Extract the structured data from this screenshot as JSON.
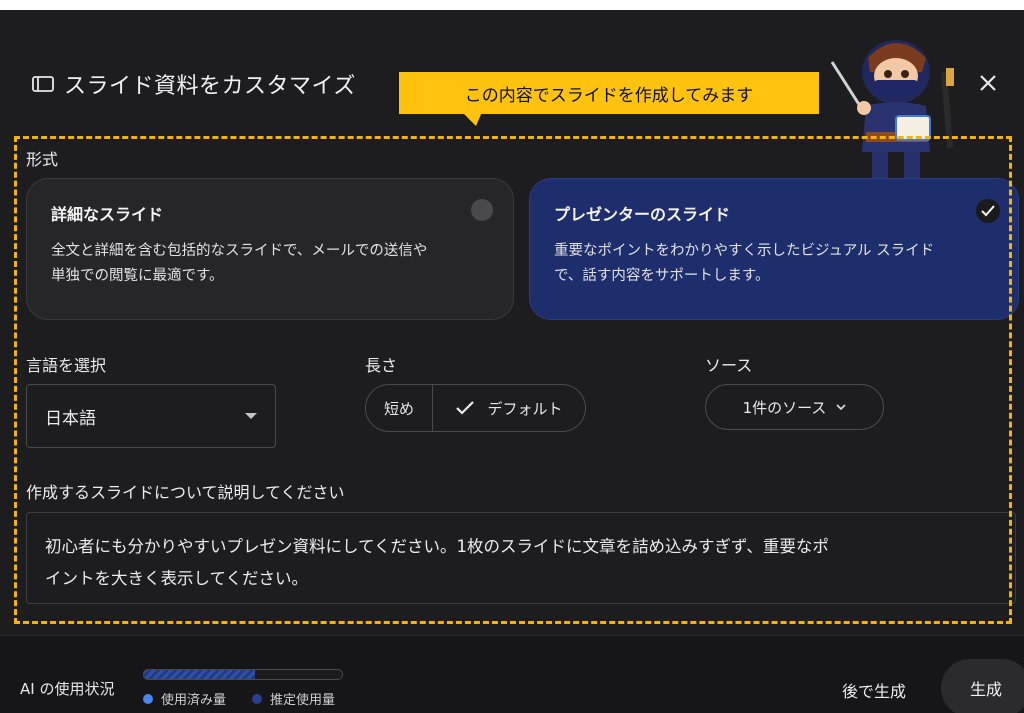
{
  "dialog": {
    "title": "スライド資料をカスタマイズ",
    "close_icon": "close-icon"
  },
  "callout": {
    "text": "この内容でスライドを作成してみます"
  },
  "format": {
    "label": "形式",
    "options": [
      {
        "title": "詳細なスライド",
        "description_line1": "全文と詳細を含む包括的なスライドで、メールでの送信や",
        "description_line2": "単独での閲覧に最適です。",
        "selected": false
      },
      {
        "title": "プレゼンターのスライド",
        "description_line1": "重要なポイントをわかりやすく示したビジュアル スライド",
        "description_line2": "で、話す内容をサポートします。",
        "selected": true
      }
    ]
  },
  "language": {
    "label": "言語を選択",
    "value": "日本語"
  },
  "length": {
    "label": "長さ",
    "short_label": "短め",
    "default_label": "デフォルト",
    "selected": "デフォルト"
  },
  "source": {
    "label": "ソース",
    "value": "1件のソース"
  },
  "description": {
    "label": "作成するスライドについて説明してください",
    "line1": "初心者にも分かりやすいプレゼン資料にしてください。1枚のスライドに文章を詰め込みすぎず、重要なポ",
    "line2": "イントを大きく表示してください。"
  },
  "footer": {
    "usage_label": "AI の使用状況",
    "usage_fraction": 0.56,
    "legend_used": "使用済み量",
    "legend_estimated": "推定使用量",
    "later_label": "後で生成",
    "generate_label": "生成"
  },
  "colors": {
    "accent_yellow": "#ffc30f",
    "selected_card": "#1e2d6b",
    "used_dot": "#4a86f0",
    "estimated_dot": "#2a3f8f"
  }
}
